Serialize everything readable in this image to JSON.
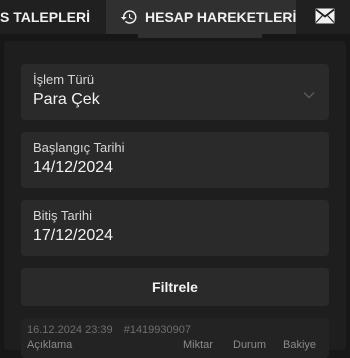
{
  "tabs": {
    "left_label": "S TALEPLERİ",
    "active_label": "HESAP HAREKETLERİ",
    "active_icon": "history-icon",
    "right_icon": "mail-icon"
  },
  "filters": {
    "transaction_type": {
      "label": "İşlem Türü",
      "value": "Para Çek"
    },
    "start_date": {
      "label": "Başlangıç Tarihi",
      "value": "14/12/2024"
    },
    "end_date": {
      "label": "Bitiş Tarihi",
      "value": "17/12/2024"
    },
    "filter_button_label": "Filtrele"
  },
  "records": [
    {
      "datetime": "16.12.2024 23:39",
      "id": "#1419930907",
      "columns": {
        "description": "Açıklama",
        "amount": "Miktar",
        "status": "Durum",
        "balance": "Bakiye"
      }
    }
  ],
  "colors": {
    "background": "#171717",
    "panel": "#1e1e1e",
    "field": "#2a2a2a",
    "active_tab": "#303030"
  }
}
